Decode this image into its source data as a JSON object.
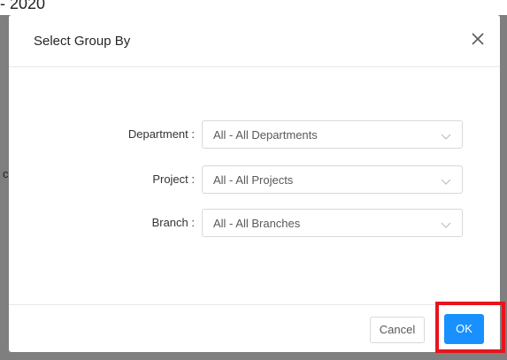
{
  "background": {
    "top_fragment": "- 2020",
    "left_fragment": "c",
    "bottom_fragment": "                                                        "
  },
  "modal": {
    "title": "Select Group By",
    "close_glyph": "X",
    "fields": [
      {
        "label": "Department :",
        "value": "All - All Departments"
      },
      {
        "label": "Project :",
        "value": "All - All Projects"
      },
      {
        "label": "Branch :",
        "value": "All - All Branches"
      }
    ],
    "cancel_label": "Cancel",
    "ok_label": "OK"
  },
  "colors": {
    "primary": "#1890ff",
    "highlight": "#e8141c",
    "overlay": "#808080"
  },
  "icons": {
    "close": "close-icon",
    "dropdown": "chevron-down-icon"
  }
}
